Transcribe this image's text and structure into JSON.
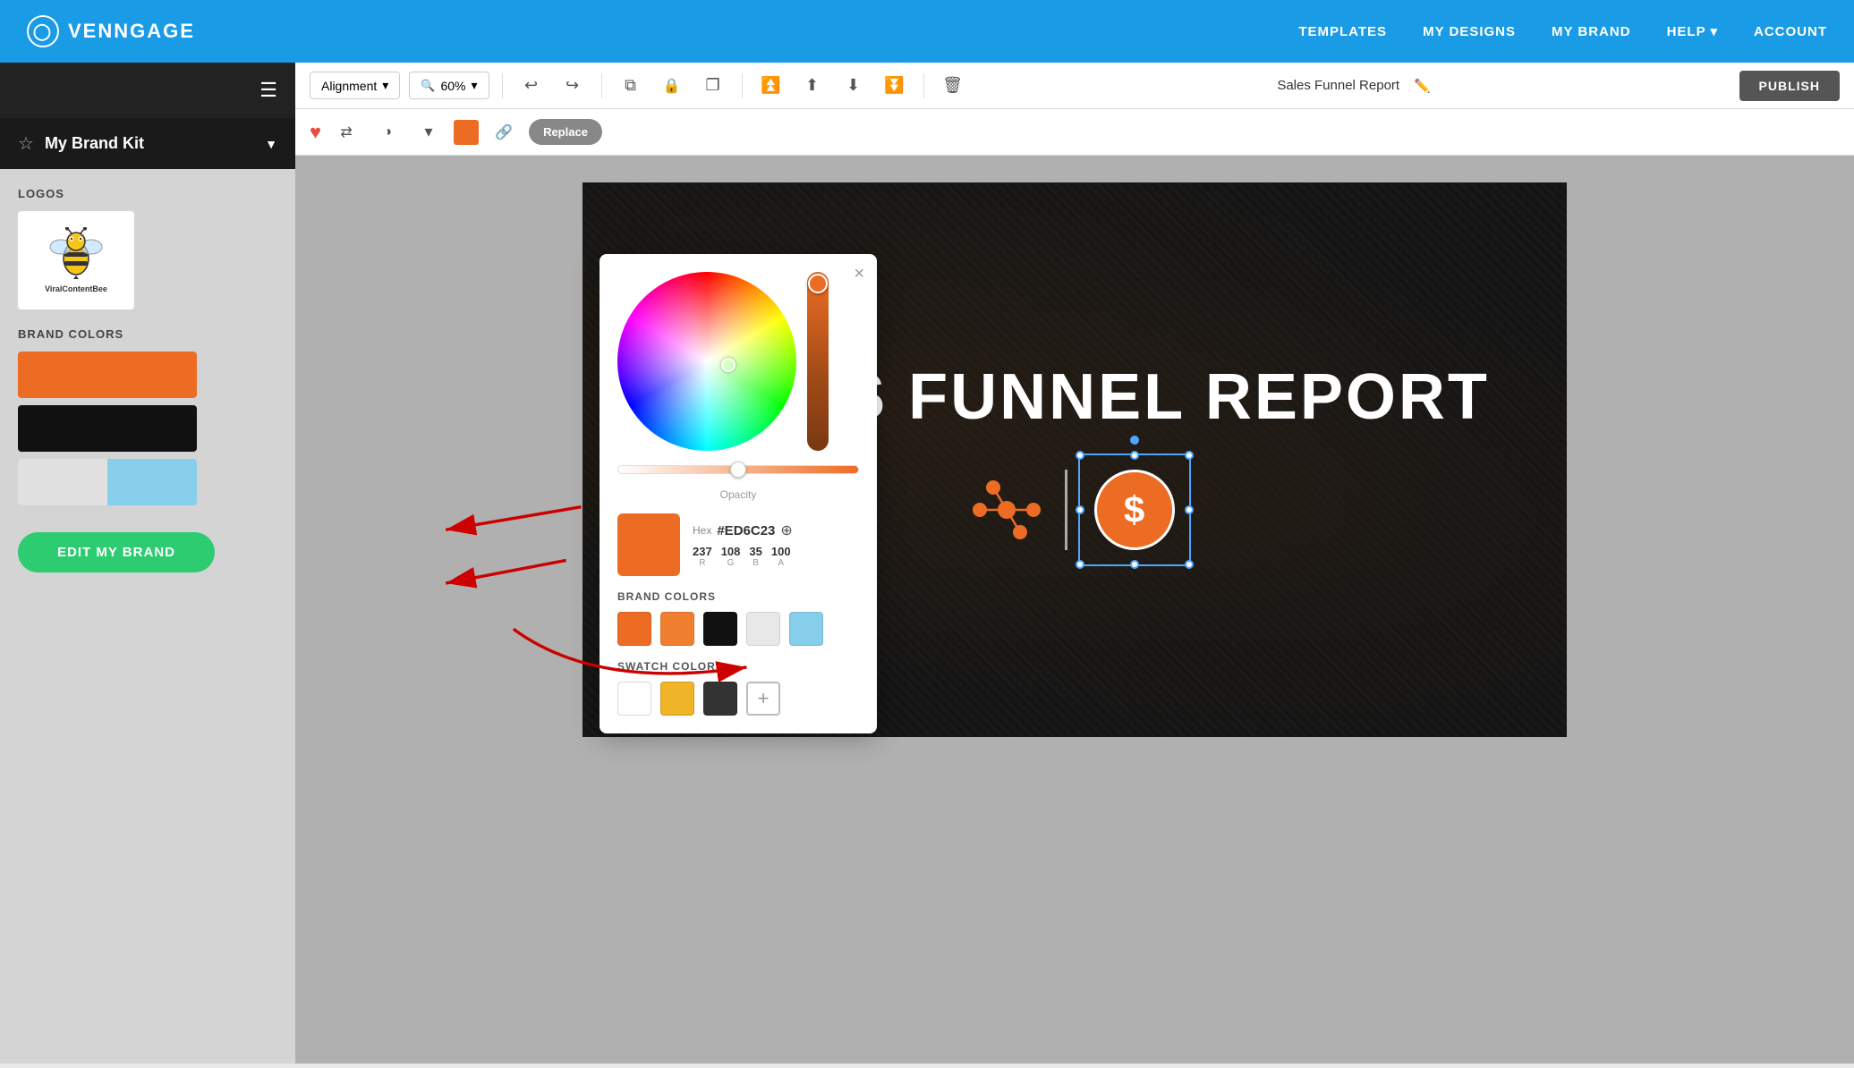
{
  "nav": {
    "logo_text": "VENNGAGE",
    "links": [
      "TEMPLATES",
      "MY DESIGNS",
      "MY BRAND",
      "HELP",
      "ACCOUNT"
    ]
  },
  "sidebar": {
    "brand_kit_label": "My Brand Kit",
    "sections": {
      "logos_label": "LOGOS",
      "brand_colors_label": "BRAND COLORS",
      "edit_btn": "EDIT MY BRAND"
    },
    "brand_colors": [
      {
        "color": "#ED6C23"
      },
      {
        "color": "#000000"
      },
      {
        "color": "#e0e0e0",
        "color2": "#87ceeb"
      }
    ]
  },
  "toolbar": {
    "alignment_label": "Alignment",
    "zoom_label": "60%",
    "doc_title": "Sales Funnel Report",
    "publish_label": "PUBLISH",
    "replace_label": "Replace"
  },
  "color_picker": {
    "close_label": "×",
    "hex_label": "Hex",
    "hex_value": "#ED6C23",
    "r": "237",
    "g": "108",
    "b": "35",
    "a": "100",
    "opacity_label": "Opacity",
    "brand_colors_label": "BRAND COLORS",
    "swatch_colors_label": "SWATCH COLORS",
    "brand_colors": [
      "#ED6C23",
      "#f08030",
      "#000000",
      "#e8e8e8",
      "#87ceeb"
    ],
    "swatch_colors": [
      "#ffffff",
      "#f0b429",
      "#333333"
    ]
  },
  "canvas": {
    "title": "SALES FUNNEL REPORT"
  }
}
